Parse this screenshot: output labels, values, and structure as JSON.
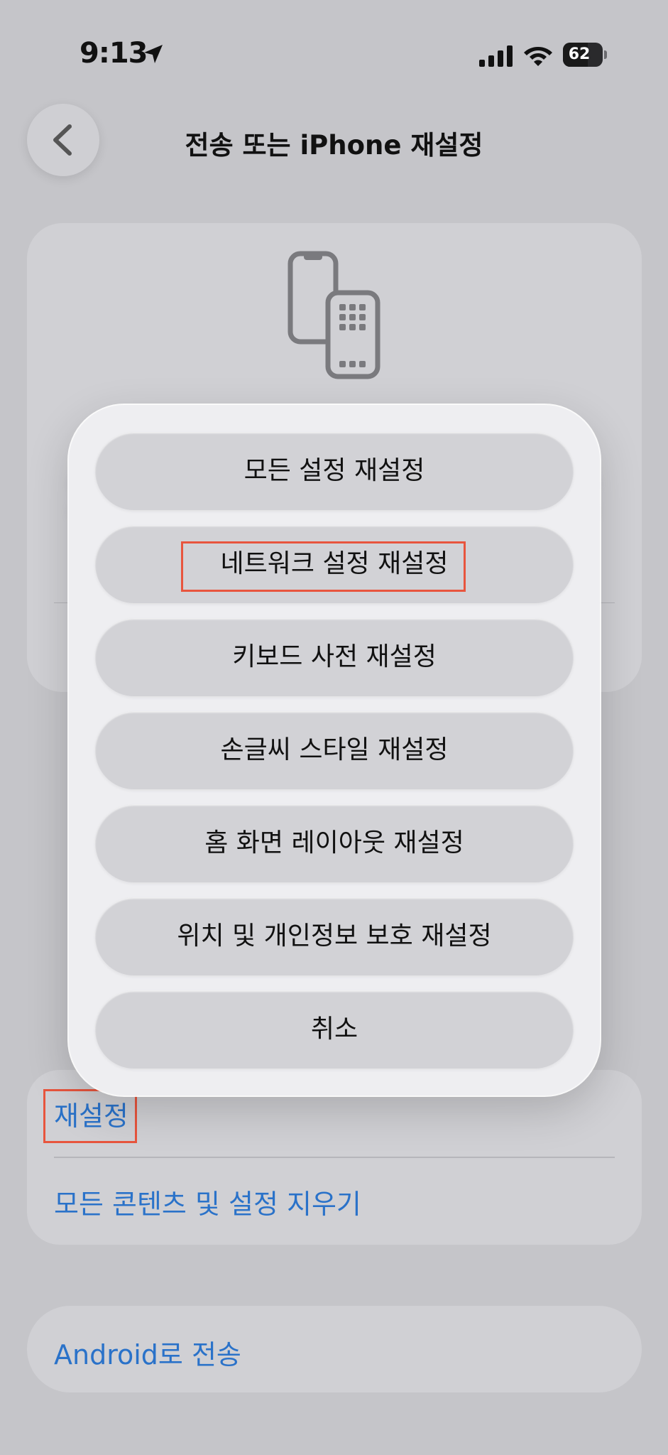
{
  "status_bar": {
    "time": "9:13",
    "battery_level": "62",
    "battery_fraction": 0.62,
    "icons": [
      "location-arrow-icon",
      "cellular-signal-icon",
      "wifi-icon",
      "battery-icon"
    ]
  },
  "nav": {
    "title": "전송 또는 iPhone 재설정",
    "back_icon": "chevron-left-icon"
  },
  "menu": {
    "items": [
      {
        "label": "모든 설정 재설정"
      },
      {
        "label": "네트워크 설정 재설정"
      },
      {
        "label": "키보드 사전 재설정"
      },
      {
        "label": "손글씨 스타일 재설정"
      },
      {
        "label": "홈 화면 레이아웃 재설정"
      },
      {
        "label": "위치 및 개인정보 보호 재설정"
      },
      {
        "label": "취소"
      }
    ]
  },
  "reset_group": {
    "reset_label": "재설정",
    "erase_label": "모든 콘텐츠 및 설정 지우기"
  },
  "android": {
    "label": "Android로 전송"
  },
  "colors": {
    "background": "#c5c5c9",
    "link": "#2a72c9",
    "highlight": "#e8553e",
    "sheet": "#eeeef1",
    "menu_item": "#d2d2d6"
  }
}
